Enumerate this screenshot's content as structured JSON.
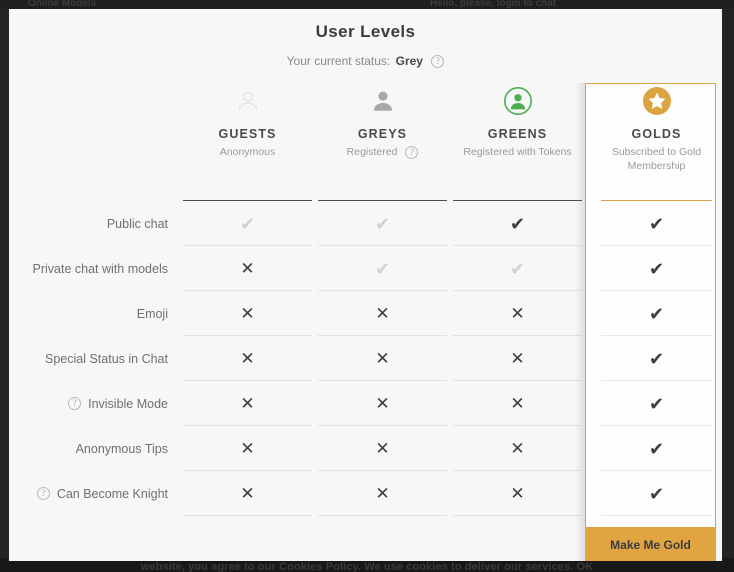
{
  "backdrop": {
    "cookie_notice": "website, you agree to our Cookies Policy. We use cookies to deliver our services.   OK",
    "nav_left": "Online Models",
    "nav_right": "Hello, please, login to chat"
  },
  "modal": {
    "title": "User Levels",
    "status_label": "Your current status:",
    "status_value": "Grey",
    "status_help_icon": "question-circle-icon"
  },
  "columns": [
    {
      "id": "guests",
      "name": "GUESTS",
      "subtitle": "Anonymous",
      "icon": "person-outline-icon",
      "has_subtitle_help": false,
      "highlighted": false
    },
    {
      "id": "greys",
      "name": "GREYS",
      "subtitle": "Registered",
      "icon": "person-solid-icon",
      "has_subtitle_help": true,
      "subtitle_help_icon": "question-circle-icon",
      "highlighted": false
    },
    {
      "id": "greens",
      "name": "GREENS",
      "subtitle": "Registered with Tokens",
      "icon": "person-circle-green-icon",
      "has_subtitle_help": false,
      "highlighted": false
    },
    {
      "id": "golds",
      "name": "GOLDS",
      "subtitle": "Subscribed to Gold Membership",
      "icon": "star-circle-gold-icon",
      "has_subtitle_help": false,
      "highlighted": true
    }
  ],
  "features": [
    {
      "label": "Public chat",
      "help_icon": null,
      "values": [
        "check-light",
        "check-light",
        "check-dark",
        "check-dark"
      ]
    },
    {
      "label": "Private chat with models",
      "help_icon": null,
      "values": [
        "cross-dark",
        "check-light",
        "check-light",
        "check-dark"
      ]
    },
    {
      "label": "Emoji",
      "help_icon": null,
      "values": [
        "cross-dark",
        "cross-dark",
        "cross-dark",
        "check-dark"
      ]
    },
    {
      "label": "Special Status in Chat",
      "help_icon": null,
      "values": [
        "cross-dark",
        "cross-dark",
        "cross-dark",
        "check-dark"
      ]
    },
    {
      "label": "Invisible Mode",
      "help_icon": "question-circle-icon",
      "values": [
        "cross-dark",
        "cross-dark",
        "cross-dark",
        "check-dark"
      ]
    },
    {
      "label": "Anonymous Tips",
      "help_icon": null,
      "values": [
        "cross-dark",
        "cross-dark",
        "cross-dark",
        "check-dark"
      ]
    },
    {
      "label": "Can Become Knight",
      "help_icon": "question-circle-icon",
      "values": [
        "cross-dark",
        "cross-dark",
        "cross-dark",
        "check-dark"
      ]
    }
  ],
  "cta": {
    "label": "Make Me Gold"
  },
  "glyphs": {
    "check-light": "✔",
    "check-dark": "✔",
    "cross-dark": "✕",
    "help": "?"
  },
  "colors": {
    "gold": "#d9a441",
    "gold_button": "#e0a441",
    "green": "#4caf50",
    "modal_bg": "#f7f7f7",
    "page_bg": "#242424",
    "text_dark": "#3f3f3f",
    "text_muted": "#9a9a9a",
    "mark_light": "#d2d2d2"
  }
}
